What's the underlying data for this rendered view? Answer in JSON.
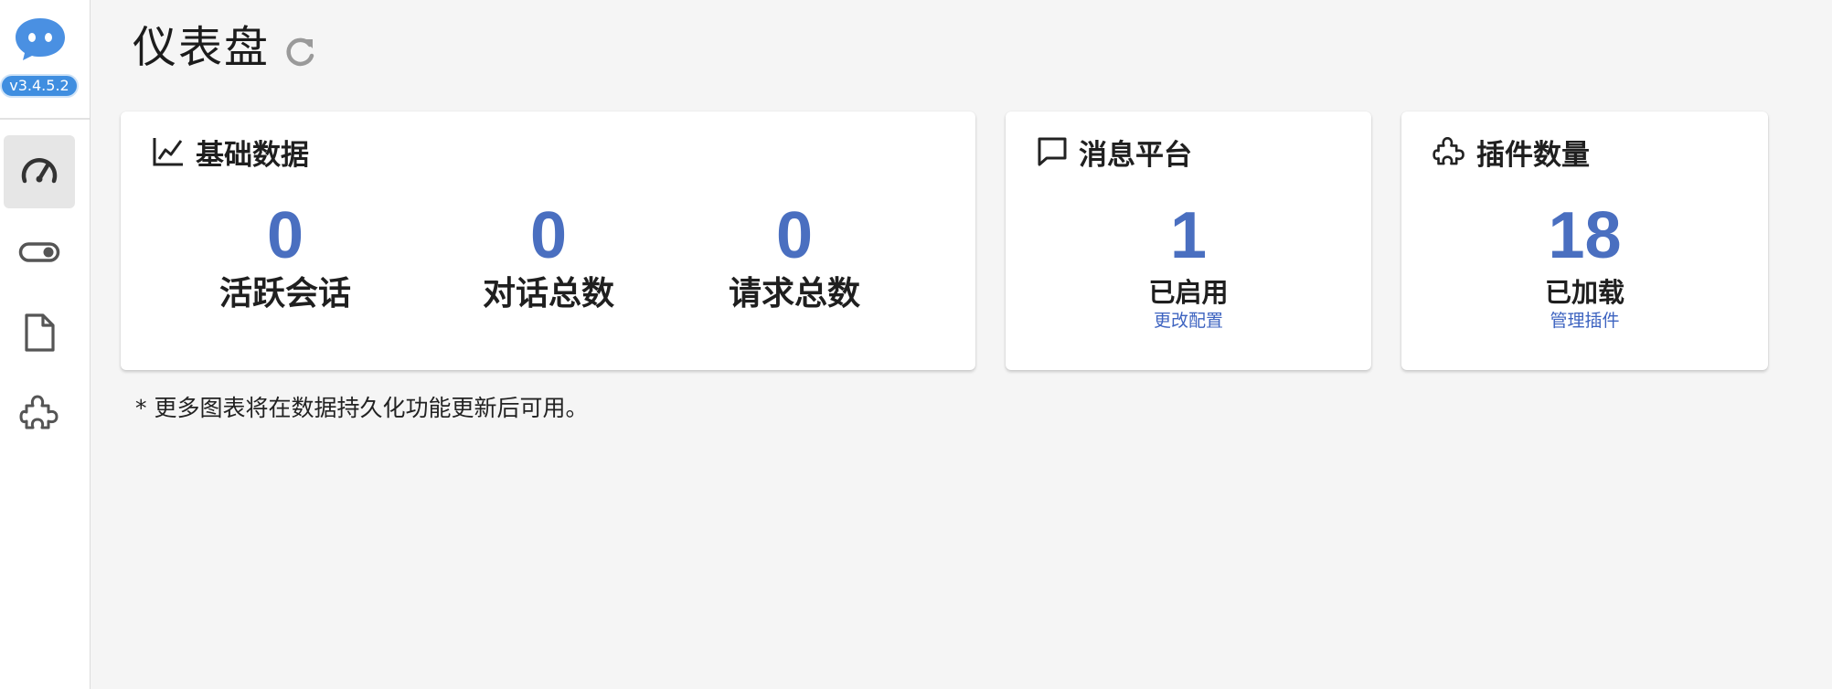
{
  "app": {
    "version": "v3.4.5.2"
  },
  "sidebar": {
    "items": [
      {
        "icon": "dashboard-gauge-icon",
        "active": true
      },
      {
        "icon": "toggle-switch-icon",
        "active": false
      },
      {
        "icon": "document-icon",
        "active": false
      },
      {
        "icon": "puzzle-plugin-icon",
        "active": false
      }
    ]
  },
  "page": {
    "title": "仪表盘"
  },
  "cards": {
    "basic": {
      "title": "基础数据",
      "stats": [
        {
          "value": "0",
          "label": "活跃会话"
        },
        {
          "value": "0",
          "label": "对话总数"
        },
        {
          "value": "0",
          "label": "请求总数"
        }
      ]
    },
    "platform": {
      "title": "消息平台",
      "value": "1",
      "label": "已启用",
      "link": "更改配置"
    },
    "plugins": {
      "title": "插件数量",
      "value": "18",
      "label": "已加载",
      "link": "管理插件"
    }
  },
  "footnote": "* 更多图表将在数据持久化功能更新后可用。",
  "colors": {
    "accent": "#4a6fc0",
    "version_badge": "#3f8ee0",
    "background": "#f5f5f5"
  }
}
